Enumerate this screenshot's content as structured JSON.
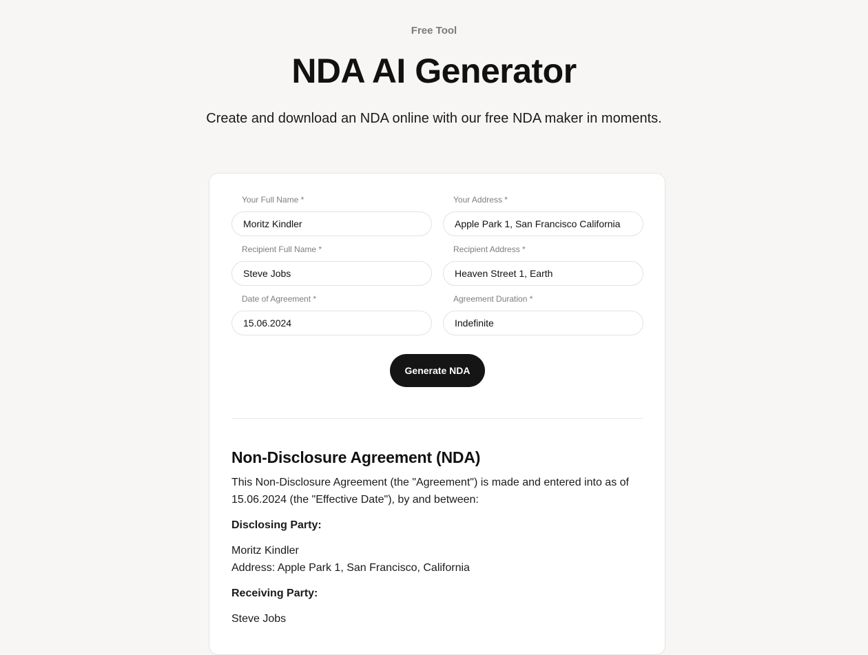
{
  "hero": {
    "eyebrow": "Free Tool",
    "title": "NDA AI Generator",
    "subtitle": "Create and download an NDA online with our free NDA maker in moments."
  },
  "form": {
    "your_name": {
      "label": "Your Full Name *",
      "value": "Moritz Kindler"
    },
    "your_address": {
      "label": "Your Address *",
      "value": "Apple Park 1, San Francisco California"
    },
    "recipient_name": {
      "label": "Recipient Full Name *",
      "value": "Steve Jobs"
    },
    "recipient_address": {
      "label": "Recipient Address *",
      "value": "Heaven Street 1, Earth"
    },
    "date": {
      "label": "Date of Agreement *",
      "value": "15.06.2024"
    },
    "duration": {
      "label": "Agreement Duration *",
      "value": "Indefinite"
    },
    "submit_label": "Generate NDA"
  },
  "document": {
    "heading": "Non-Disclosure Agreement (NDA)",
    "intro_line1": "This Non-Disclosure Agreement (the \"Agreement\") is made and entered into as of",
    "intro_line2": "15.06.2024 (the \"Effective Date\"), by and between:",
    "disclosing_heading": "Disclosing Party:",
    "disclosing_name": "Moritz Kindler",
    "disclosing_address": "Address: Apple Park 1, San Francisco, California",
    "receiving_heading": "Receiving Party:",
    "receiving_name": "Steve Jobs"
  },
  "colors": {
    "page_background": "#f7f6f4",
    "button_background": "#151515",
    "card_background": "#ffffff"
  }
}
